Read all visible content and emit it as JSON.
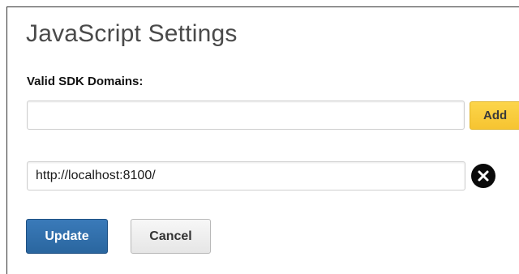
{
  "page": {
    "title": "JavaScript Settings"
  },
  "domains_section": {
    "label": "Valid SDK Domains:",
    "new_domain_value": "",
    "add_label": "Add",
    "entries": [
      {
        "value": "http://localhost:8100/",
        "remove_icon": "close-circle-icon"
      }
    ]
  },
  "actions": {
    "update_label": "Update",
    "cancel_label": "Cancel"
  },
  "colors": {
    "add_button": "#f6c431",
    "update_button": "#2a669f",
    "remove_icon": "#0a0a0a"
  }
}
